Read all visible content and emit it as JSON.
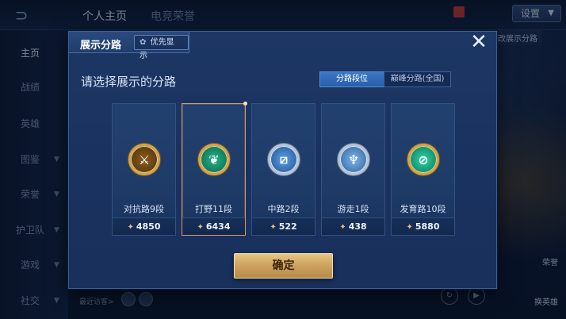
{
  "background": {
    "top_tabs": [
      "个人主页",
      "电竞荣誉"
    ],
    "settings_label": "设置",
    "corner_label": "更改展示分路",
    "sidebar_items": [
      {
        "label": "主页",
        "active": true
      },
      {
        "label": "战绩"
      },
      {
        "label": "英雄"
      },
      {
        "label": "图鉴"
      },
      {
        "label": "荣誉"
      },
      {
        "label": "护卫队"
      },
      {
        "label": "游戏"
      },
      {
        "label": "社交"
      }
    ],
    "recent_visitors": "最近访客>",
    "right_labels": {
      "hero": "荣誉",
      "swap": "换英雄"
    }
  },
  "modal": {
    "title": "展示分路",
    "priority_badge": "优先显示",
    "close_icon": "close-icon",
    "heading": "请选择展示的分路",
    "segments": [
      {
        "label": "分路段位",
        "active": true
      },
      {
        "label": "巅峰分路(全国)",
        "active": false
      }
    ],
    "cards": [
      {
        "label": "对抗路9段",
        "score": "4850",
        "icon": "top-lane-emblem-icon",
        "selected": false
      },
      {
        "label": "打野11段",
        "score": "6434",
        "icon": "jungle-emblem-icon",
        "selected": true
      },
      {
        "label": "中路2段",
        "score": "522",
        "icon": "mid-lane-emblem-icon",
        "selected": false
      },
      {
        "label": "游走1段",
        "score": "438",
        "icon": "roam-emblem-icon",
        "selected": false
      },
      {
        "label": "发育路10段",
        "score": "5880",
        "icon": "farm-lane-emblem-icon",
        "selected": false
      }
    ],
    "confirm_label": "确定"
  }
}
